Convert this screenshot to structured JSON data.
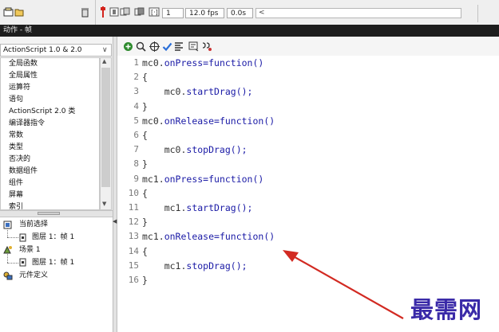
{
  "timeline": {
    "frame_value": "1",
    "fps_value": "12.0 fps",
    "time_value": "0.0s",
    "scroll_left": "<"
  },
  "panel": {
    "title": "动作 - 帧"
  },
  "left_panel": {
    "version_select": "ActionScript 1.0 & 2.0",
    "version_chevron": "∨",
    "categories": [
      "全局函数",
      "全局属性",
      "运算符",
      "语句",
      "ActionScript 2.0 类",
      "编译器指令",
      "常数",
      "类型",
      "否决的",
      "数据组件",
      "组件",
      "屏幕",
      "索引"
    ],
    "tree": [
      {
        "label": "当前选择"
      },
      {
        "label": "图层 1：帧 1"
      },
      {
        "label": "场景 1"
      },
      {
        "label": "图层 1：帧 1"
      },
      {
        "label": "元件定义"
      }
    ]
  },
  "editor": {
    "toolbar_icons": [
      "add-script-icon",
      "find-icon",
      "target-icon",
      "check-syntax-icon",
      "auto-format-icon",
      "code-hint-icon",
      "debug-options-icon"
    ],
    "lines": [
      {
        "num": "1",
        "obj": "mc0.",
        "kw": "onPress=function()"
      },
      {
        "num": "2",
        "obj": "{",
        "kw": ""
      },
      {
        "num": "3",
        "obj": "    mc0.",
        "kw": "startDrag();"
      },
      {
        "num": "4",
        "obj": "}",
        "kw": ""
      },
      {
        "num": "5",
        "obj": "mc0.",
        "kw": "onRelease=function()"
      },
      {
        "num": "6",
        "obj": "{",
        "kw": ""
      },
      {
        "num": "7",
        "obj": "    mc0.",
        "kw": "stopDrag();"
      },
      {
        "num": "8",
        "obj": "}",
        "kw": ""
      },
      {
        "num": "9",
        "obj": "mc1.",
        "kw": "onPress=function()"
      },
      {
        "num": "10",
        "obj": "{",
        "kw": ""
      },
      {
        "num": "11",
        "obj": "    mc1.",
        "kw": "startDrag();"
      },
      {
        "num": "12",
        "obj": "}",
        "kw": ""
      },
      {
        "num": "13",
        "obj": "mc1.",
        "kw": "onRelease=function()"
      },
      {
        "num": "14",
        "obj": "{",
        "kw": ""
      },
      {
        "num": "15",
        "obj": "    mc1.",
        "kw": "stopDrag();"
      },
      {
        "num": "16",
        "obj": "}",
        "kw": ""
      }
    ]
  },
  "watermark": "最需网",
  "colors": {
    "keyword": "#1a1aa6",
    "arrow": "#d22a22",
    "watermark": "#3a2aa8"
  }
}
